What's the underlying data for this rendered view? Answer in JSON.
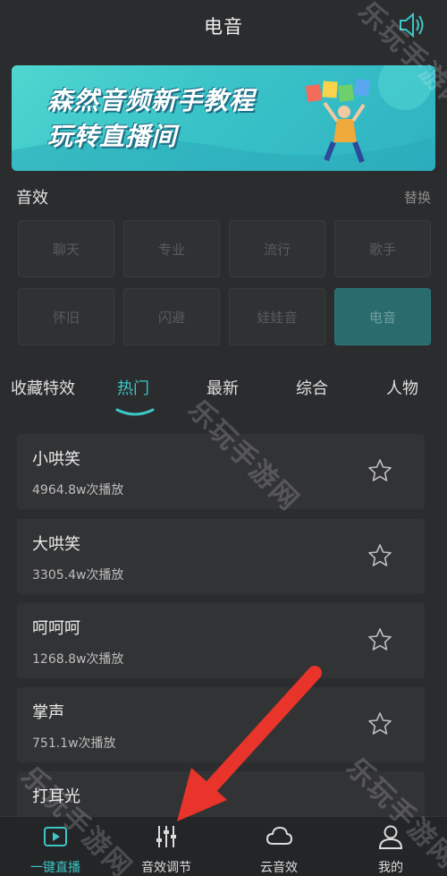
{
  "header": {
    "title": "电音"
  },
  "banner": {
    "line1": "森然音频新手教程",
    "line2": "玩转直播间"
  },
  "effects": {
    "label": "音效",
    "swap_label": "替换",
    "chips": [
      "聊天",
      "专业",
      "流行",
      "歌手",
      "怀旧",
      "闪避",
      "娃娃音",
      "电音"
    ],
    "active_index": 7
  },
  "tabs": [
    "收藏特效",
    "热门",
    "最新",
    "综合",
    "人物"
  ],
  "active_tab": 1,
  "list": [
    {
      "name": "小哄笑",
      "plays": "4964.8w次播放"
    },
    {
      "name": "大哄笑",
      "plays": "3305.4w次播放"
    },
    {
      "name": "呵呵呵",
      "plays": "1268.8w次播放"
    },
    {
      "name": "掌声",
      "plays": "751.1w次播放"
    },
    {
      "name": "打耳光",
      "plays": ""
    }
  ],
  "bottom_nav": [
    {
      "label": "一键直播",
      "icon": "live-play-icon"
    },
    {
      "label": "音效调节",
      "icon": "equalizer-icon"
    },
    {
      "label": "云音效",
      "icon": "cloud-icon"
    },
    {
      "label": "我的",
      "icon": "user-icon"
    }
  ],
  "active_nav": 0,
  "watermark": "乐玩手游网",
  "colors": {
    "accent": "#3cc6c6",
    "background": "#2b2c2e",
    "chip_active": "#2a6c6e",
    "arrow": "#e8342a"
  }
}
